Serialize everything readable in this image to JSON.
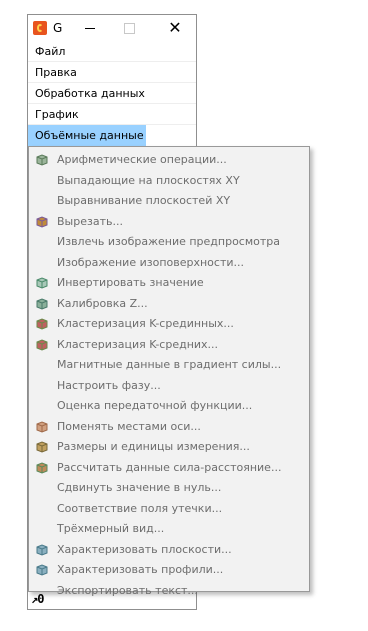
{
  "window": {
    "title": "G",
    "close_glyph": "✕"
  },
  "menubar": {
    "items": [
      {
        "label": "Файл"
      },
      {
        "label": "Правка"
      },
      {
        "label": "Обработка данных"
      },
      {
        "label": "График"
      },
      {
        "label": "Объёмные данные"
      }
    ]
  },
  "bottom_glyph": "↗0",
  "dropdown": {
    "items": [
      {
        "label": "Арифметические операции...",
        "icon": "arithmetic-icon"
      },
      {
        "label": "Выпадающие на плоскостях XY",
        "icon": ""
      },
      {
        "label": "Выравнивание плоскостей XY",
        "icon": ""
      },
      {
        "label": "Вырезать...",
        "icon": "cut-volume-icon"
      },
      {
        "label": "Извлечь изображение предпросмотра",
        "icon": ""
      },
      {
        "label": "Изображение изоповерхности...",
        "icon": ""
      },
      {
        "label": "Инвертировать значение",
        "icon": "invert-icon"
      },
      {
        "label": "Калибровка Z...",
        "icon": "calibration-icon"
      },
      {
        "label": "Кластеризация K-срединных...",
        "icon": "kmedians-icon"
      },
      {
        "label": "Кластеризация K-средних...",
        "icon": "kmeans-icon"
      },
      {
        "label": "Магнитные данные в градиент силы...",
        "icon": ""
      },
      {
        "label": "Настроить фазу...",
        "icon": ""
      },
      {
        "label": "Оценка передаточной функции...",
        "icon": ""
      },
      {
        "label": "Поменять местами оси...",
        "icon": "swap-axes-icon"
      },
      {
        "label": "Размеры и единицы измерения...",
        "icon": "dimensions-icon"
      },
      {
        "label": "Рассчитать данные сила-расстояние...",
        "icon": "force-distance-icon"
      },
      {
        "label": "Сдвинуть значение в нуль...",
        "icon": ""
      },
      {
        "label": "Соответствие поля утечки...",
        "icon": ""
      },
      {
        "label": "Трёхмерный вид...",
        "icon": ""
      },
      {
        "label": "Характеризовать плоскости...",
        "icon": "characterize-planes-icon"
      },
      {
        "label": "Характеризовать профили...",
        "icon": "characterize-profiles-icon"
      },
      {
        "label": "Экспортировать текст...",
        "icon": ""
      }
    ]
  }
}
